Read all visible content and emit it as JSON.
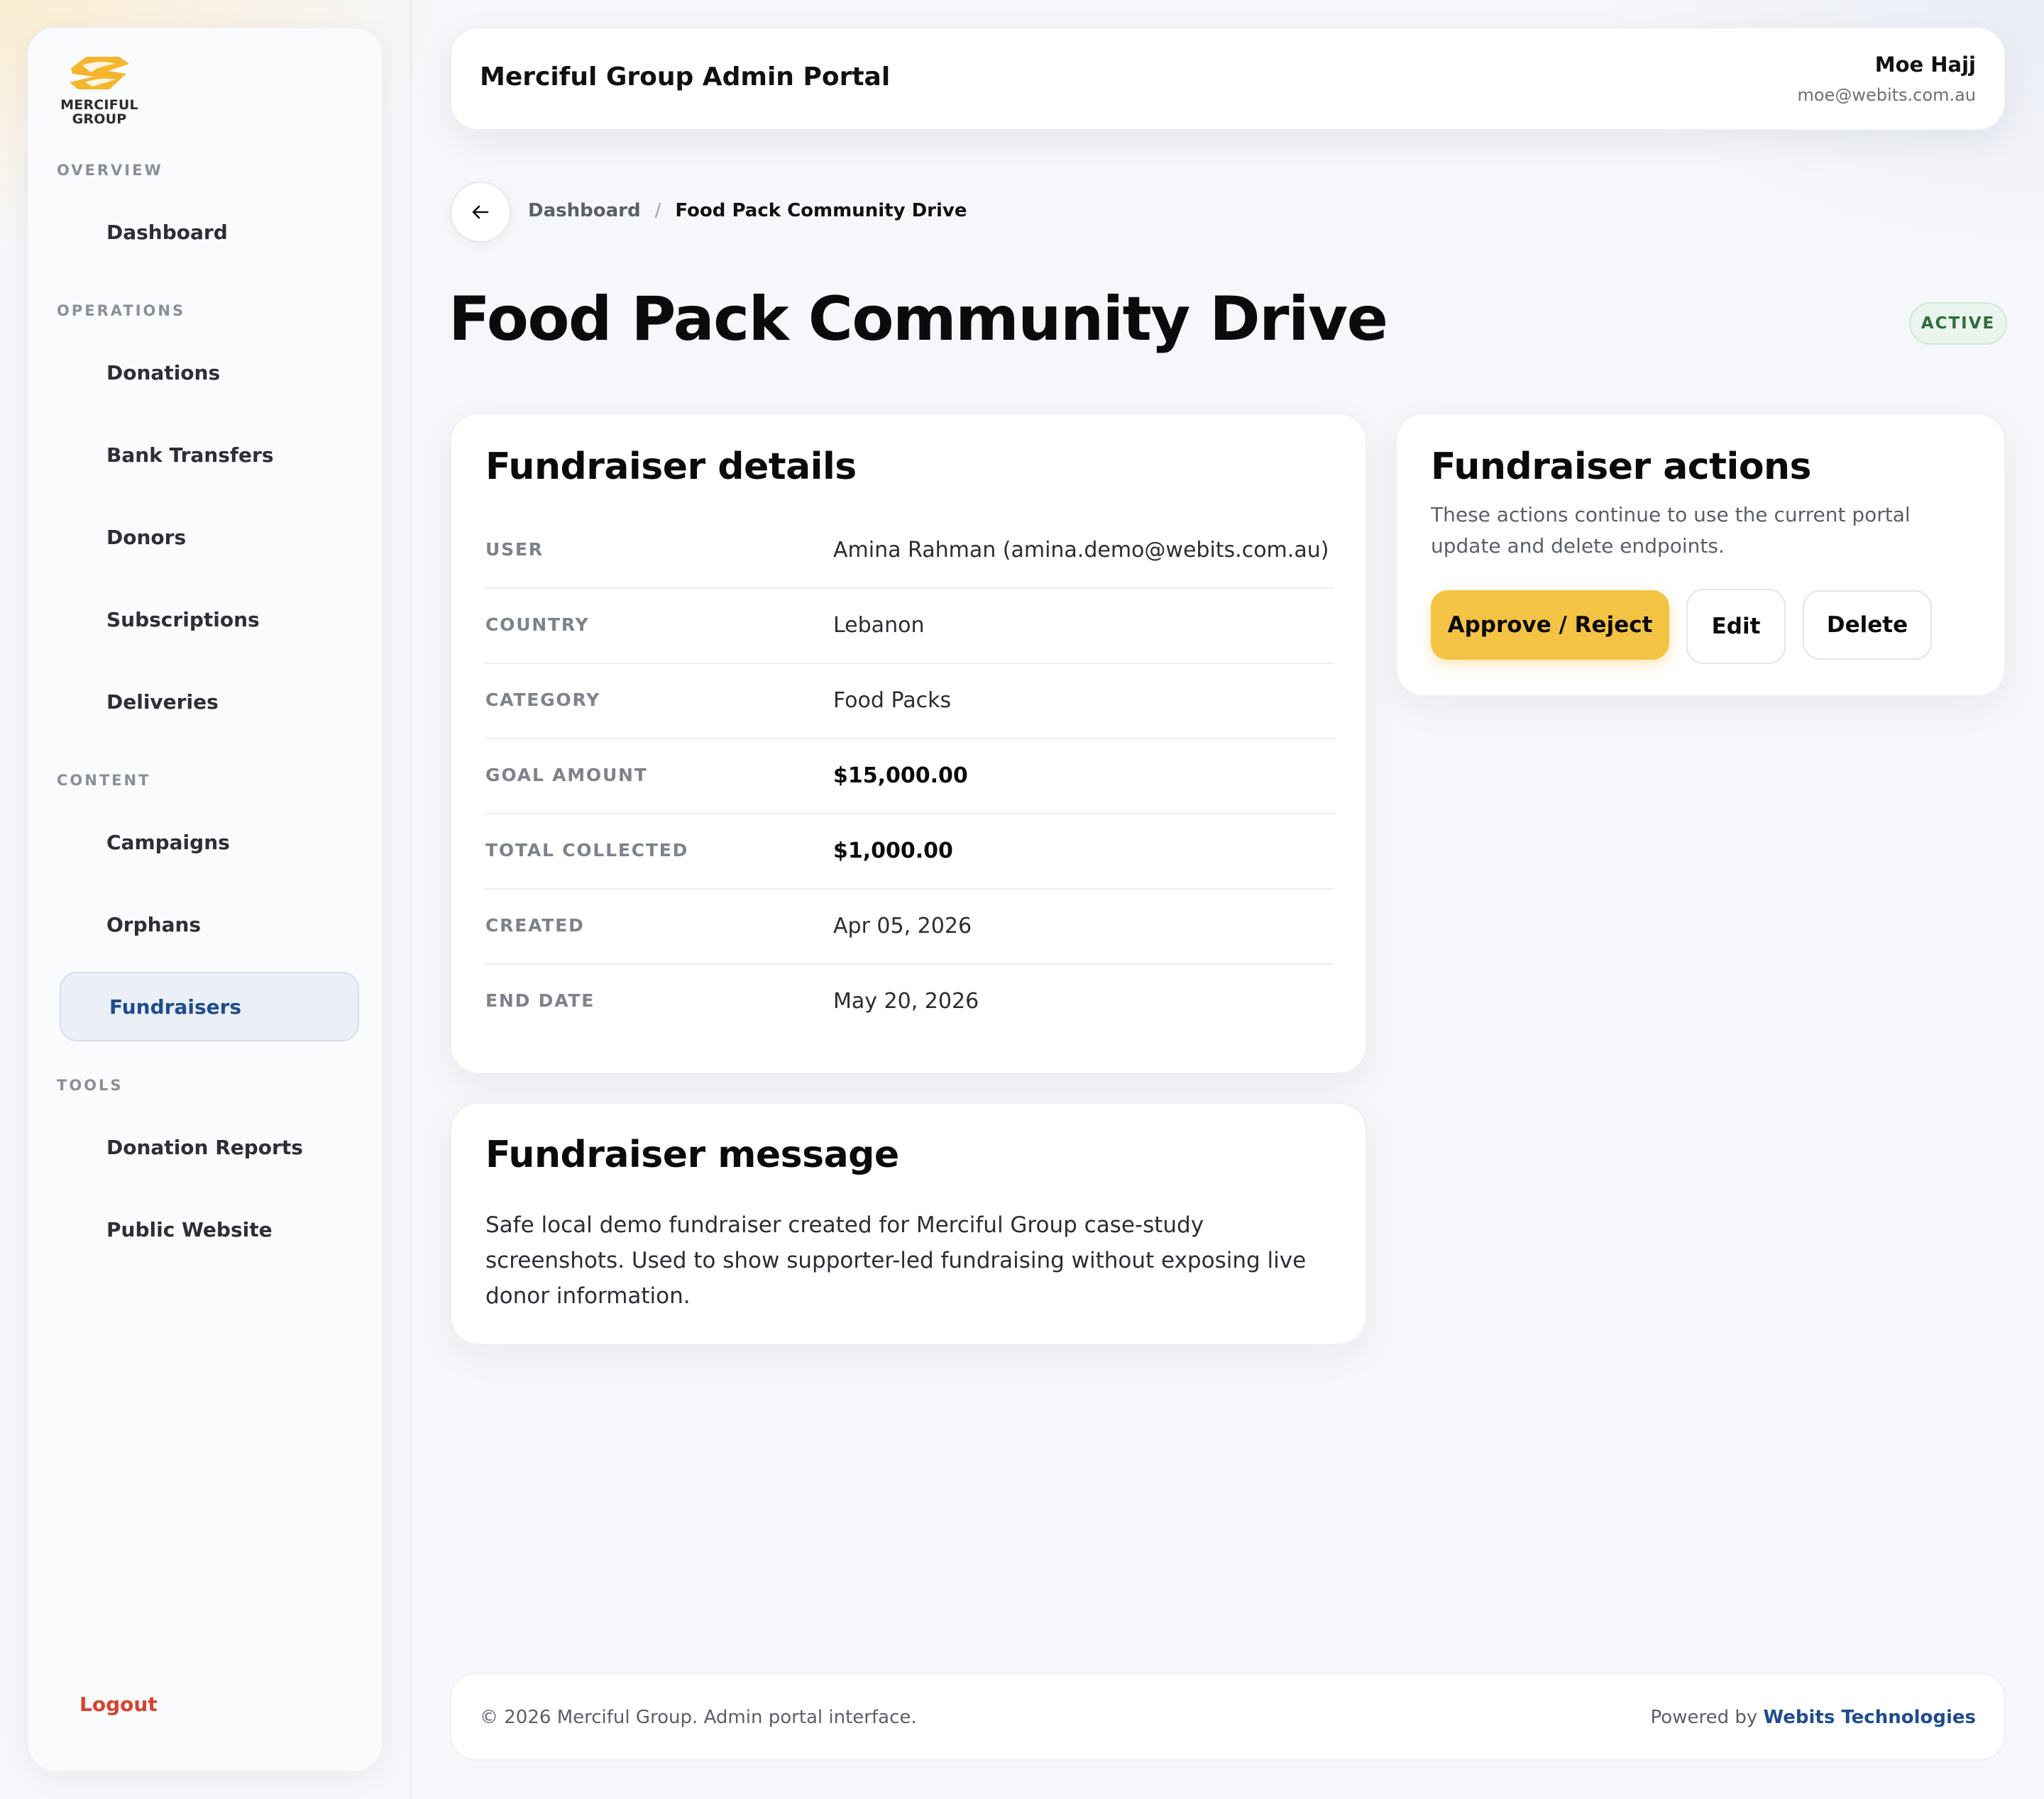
{
  "brand": {
    "logo_text": "MERCIFUL\nGROUP",
    "accent_color": "#f5c344"
  },
  "sidebar": {
    "sections": [
      {
        "label": "OVERVIEW",
        "items": [
          {
            "label": "Dashboard"
          }
        ]
      },
      {
        "label": "OPERATIONS",
        "items": [
          {
            "label": "Donations"
          },
          {
            "label": "Bank Transfers"
          },
          {
            "label": "Donors"
          },
          {
            "label": "Subscriptions"
          },
          {
            "label": "Deliveries"
          }
        ]
      },
      {
        "label": "CONTENT",
        "items": [
          {
            "label": "Campaigns"
          },
          {
            "label": "Orphans"
          },
          {
            "label": "Fundraisers",
            "active": true
          }
        ]
      },
      {
        "label": "TOOLS",
        "items": [
          {
            "label": "Donation Reports"
          },
          {
            "label": "Public Website"
          }
        ]
      }
    ],
    "logout_label": "Logout",
    "active_color": "#1f4b8f",
    "logout_color": "#d9412f"
  },
  "header": {
    "title": "Merciful Group Admin Portal",
    "user_name": "Moe Hajj",
    "user_email": "moe@webits.com.au"
  },
  "breadcrumb": {
    "back_icon": "arrow-left-icon",
    "parent": "Dashboard",
    "separator": "/",
    "current": "Food Pack Community Drive"
  },
  "page": {
    "title": "Food Pack Community Drive",
    "status": "ACTIVE",
    "status_color": "#2f6b3d"
  },
  "details": {
    "title": "Fundraiser details",
    "rows": [
      {
        "label": "USER",
        "value": "Amina Rahman (amina.demo@webits.com.au)"
      },
      {
        "label": "COUNTRY",
        "value": "Lebanon"
      },
      {
        "label": "CATEGORY",
        "value": "Food Packs"
      },
      {
        "label": "GOAL AMOUNT",
        "value": "$15,000.00"
      },
      {
        "label": "TOTAL COLLECTED",
        "value": "$1,000.00"
      },
      {
        "label": "CREATED",
        "value": "Apr 05, 2026"
      },
      {
        "label": "END DATE",
        "value": "May 20, 2026"
      }
    ]
  },
  "message": {
    "title": "Fundraiser message",
    "text": "Safe local demo fundraiser created for Merciful Group case-study screenshots. Used to show supporter-led fundraising without exposing live donor information."
  },
  "actions": {
    "title": "Fundraiser actions",
    "description": "These actions continue to use the current portal update and delete endpoints.",
    "approve_label": "Approve / Reject",
    "edit_label": "Edit",
    "delete_label": "Delete"
  },
  "footer": {
    "copyright": "© 2026 Merciful Group. Admin portal interface.",
    "powered_by": "Powered by",
    "powered_brand": "Webits Technologies"
  }
}
